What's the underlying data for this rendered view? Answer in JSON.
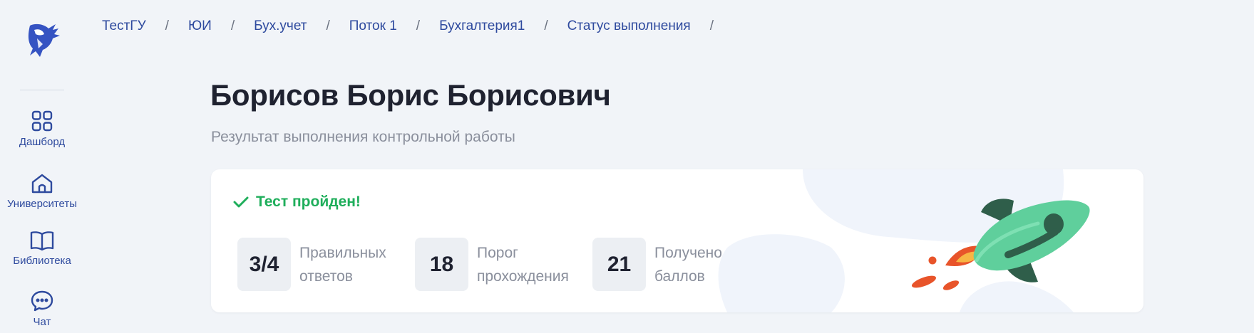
{
  "sidebar": {
    "items": [
      {
        "label": "Дашборд",
        "icon": "grid-icon"
      },
      {
        "label": "Университеты",
        "icon": "university-icon"
      },
      {
        "label": "Библиотека",
        "icon": "book-icon"
      },
      {
        "label": "Чат",
        "icon": "chat-icon"
      }
    ]
  },
  "breadcrumb": [
    "ТестГУ",
    "ЮИ",
    "Бух.учет",
    "Поток 1",
    "Бухгалтерия1",
    "Статус выполнения"
  ],
  "header": {
    "title": "Борисов Борис Борисович",
    "subtitle": "Результат выполнения контрольной работы"
  },
  "result": {
    "status": "Тест пройден!",
    "status_color": "#1fae5b",
    "stats": [
      {
        "value": "3/4",
        "label_line1": "Правильных",
        "label_line2": "ответов"
      },
      {
        "value": "18",
        "label_line1": "Порог",
        "label_line2": "прохождения"
      },
      {
        "value": "21",
        "label_line1": "Получено",
        "label_line2": "баллов"
      }
    ]
  },
  "colors": {
    "accent": "#2e4a9e",
    "background": "#f1f4f8",
    "success": "#1fae5b"
  }
}
